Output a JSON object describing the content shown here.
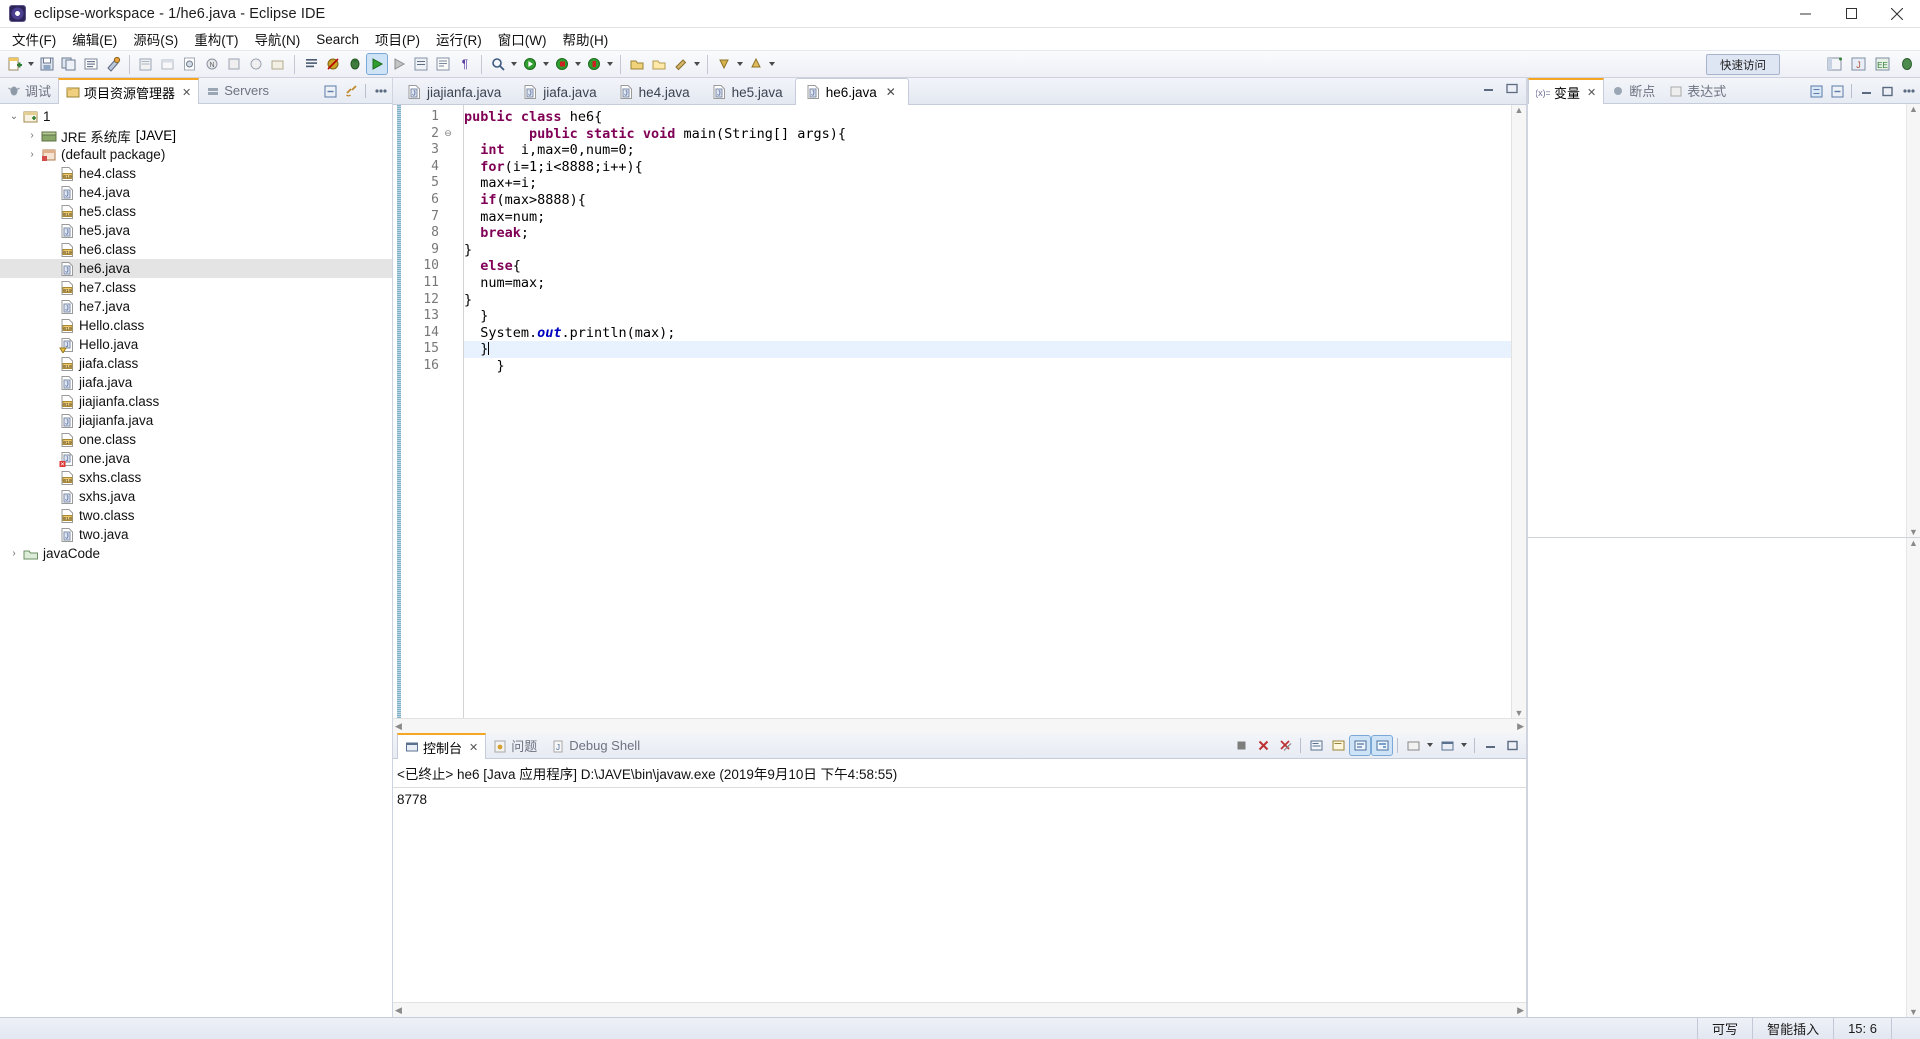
{
  "window": {
    "title": "eclipse-workspace - 1/he6.java - Eclipse IDE",
    "app_icon": "eclipse-icon",
    "minimize": "minimize-icon",
    "maximize": "maximize-icon",
    "close": "close-icon"
  },
  "menubar": {
    "items": [
      {
        "label": "文件(F)",
        "name": "menu-file"
      },
      {
        "label": "编辑(E)",
        "name": "menu-edit"
      },
      {
        "label": "源码(S)",
        "name": "menu-source"
      },
      {
        "label": "重构(T)",
        "name": "menu-refactor"
      },
      {
        "label": "导航(N)",
        "name": "menu-navigate"
      },
      {
        "label": "Search",
        "name": "menu-search"
      },
      {
        "label": "项目(P)",
        "name": "menu-project"
      },
      {
        "label": "运行(R)",
        "name": "menu-run"
      },
      {
        "label": "窗口(W)",
        "name": "menu-window"
      },
      {
        "label": "帮助(H)",
        "name": "menu-help"
      }
    ]
  },
  "toolbar": {
    "quick_access": "快速访问",
    "icons": [
      "new-wizard-icon",
      "save-icon",
      "save-all-icon",
      "print-icon",
      "build-icon",
      "new-java-project-icon",
      "new-package-icon",
      "new-class-icon",
      "new-interface-icon",
      "new-enum-icon",
      "new-annotation-icon",
      "new-source-folder-icon",
      "open-type-icon",
      "search-icon",
      "debug-icon",
      "run-icon",
      "run-external-icon",
      "coverage-icon",
      "java-browsing-icon",
      "open-task-icon",
      "pilcrow-icon",
      "skip-breakpoints-icon",
      "next-annotation-icon",
      "previous-annotation-icon",
      "last-edit-location-icon",
      "back-icon",
      "forward-icon",
      "pin-editor-icon"
    ]
  },
  "left_panel": {
    "tabs": [
      {
        "label": "调试",
        "icon": "debug-icon",
        "active": false,
        "closeable": false
      },
      {
        "label": "项目资源管理器",
        "icon": "package-explorer-icon",
        "active": true,
        "closeable": true
      },
      {
        "label": "Servers",
        "icon": "servers-icon",
        "active": false,
        "closeable": false
      }
    ],
    "view_tools": [
      "collapse-all-icon",
      "link-with-editor-icon",
      "view-menu-icon"
    ],
    "tree": [
      {
        "label": "1",
        "suffix": "",
        "icon": "java-project-icon",
        "indent": 0,
        "twisty": "open",
        "selected": false
      },
      {
        "label": "JRE 系统库",
        "suffix": "[JAVE]",
        "icon": "jre-library-icon",
        "indent": 1,
        "twisty": "closed",
        "selected": false
      },
      {
        "label": "(default package)",
        "suffix": "",
        "icon": "package-icon",
        "indent": 1,
        "twisty": "closed",
        "selected": false
      },
      {
        "label": "he4.class",
        "suffix": "",
        "icon": "class-file-icon",
        "indent": 2,
        "twisty": "none",
        "selected": false
      },
      {
        "label": "he4.java",
        "suffix": "",
        "icon": "java-file-icon",
        "indent": 2,
        "twisty": "none",
        "selected": false
      },
      {
        "label": "he5.class",
        "suffix": "",
        "icon": "class-file-icon",
        "indent": 2,
        "twisty": "none",
        "selected": false
      },
      {
        "label": "he5.java",
        "suffix": "",
        "icon": "java-file-icon",
        "indent": 2,
        "twisty": "none",
        "selected": false
      },
      {
        "label": "he6.class",
        "suffix": "",
        "icon": "class-file-icon",
        "indent": 2,
        "twisty": "none",
        "selected": false
      },
      {
        "label": "he6.java",
        "suffix": "",
        "icon": "java-file-icon",
        "indent": 2,
        "twisty": "none",
        "selected": true
      },
      {
        "label": "he7.class",
        "suffix": "",
        "icon": "class-file-icon",
        "indent": 2,
        "twisty": "none",
        "selected": false
      },
      {
        "label": "he7.java",
        "suffix": "",
        "icon": "java-file-icon",
        "indent": 2,
        "twisty": "none",
        "selected": false
      },
      {
        "label": "Hello.class",
        "suffix": "",
        "icon": "class-file-icon",
        "indent": 2,
        "twisty": "none",
        "selected": false
      },
      {
        "label": "Hello.java",
        "suffix": "",
        "icon": "java-file-warning-icon",
        "indent": 2,
        "twisty": "none",
        "selected": false
      },
      {
        "label": "jiafa.class",
        "suffix": "",
        "icon": "class-file-icon",
        "indent": 2,
        "twisty": "none",
        "selected": false
      },
      {
        "label": "jiafa.java",
        "suffix": "",
        "icon": "java-file-icon",
        "indent": 2,
        "twisty": "none",
        "selected": false
      },
      {
        "label": "jiajianfa.class",
        "suffix": "",
        "icon": "class-file-icon",
        "indent": 2,
        "twisty": "none",
        "selected": false
      },
      {
        "label": "jiajianfa.java",
        "suffix": "",
        "icon": "java-file-icon",
        "indent": 2,
        "twisty": "none",
        "selected": false
      },
      {
        "label": "one.class",
        "suffix": "",
        "icon": "class-file-icon",
        "indent": 2,
        "twisty": "none",
        "selected": false
      },
      {
        "label": "one.java",
        "suffix": "",
        "icon": "java-file-error-icon",
        "indent": 2,
        "twisty": "none",
        "selected": false
      },
      {
        "label": "sxhs.class",
        "suffix": "",
        "icon": "class-file-icon",
        "indent": 2,
        "twisty": "none",
        "selected": false
      },
      {
        "label": "sxhs.java",
        "suffix": "",
        "icon": "java-file-icon",
        "indent": 2,
        "twisty": "none",
        "selected": false
      },
      {
        "label": "two.class",
        "suffix": "",
        "icon": "class-file-icon",
        "indent": 2,
        "twisty": "none",
        "selected": false
      },
      {
        "label": "two.java",
        "suffix": "",
        "icon": "java-file-icon",
        "indent": 2,
        "twisty": "none",
        "selected": false
      },
      {
        "label": "javaCode",
        "suffix": "",
        "icon": "closed-project-icon",
        "indent": 0,
        "twisty": "closed",
        "selected": false
      }
    ]
  },
  "editor": {
    "tabs": [
      {
        "label": "jiajianfa.java",
        "icon": "java-file-icon",
        "active": false,
        "closeable": false
      },
      {
        "label": "jiafa.java",
        "icon": "java-file-icon",
        "active": false,
        "closeable": false
      },
      {
        "label": "he4.java",
        "icon": "java-file-icon",
        "active": false,
        "closeable": false
      },
      {
        "label": "he5.java",
        "icon": "java-file-icon",
        "active": false,
        "closeable": false
      },
      {
        "label": "he6.java",
        "icon": "java-file-icon",
        "active": true,
        "closeable": true
      }
    ],
    "minimize_icon": "minimize-view-icon",
    "maximize_icon": "maximize-view-icon",
    "line_numbers": [
      1,
      2,
      3,
      4,
      5,
      6,
      7,
      8,
      9,
      10,
      11,
      12,
      13,
      14,
      15,
      16
    ],
    "current_line": 15,
    "fold_marker_line": 2,
    "code": [
      {
        "n": 1,
        "tokens": [
          {
            "t": "public ",
            "c": "k"
          },
          {
            "t": "class ",
            "c": "k"
          },
          {
            "t": "he6{",
            "c": "plain"
          }
        ]
      },
      {
        "n": 2,
        "tokens": [
          {
            "t": "        public ",
            "c": "k"
          },
          {
            "t": "static ",
            "c": "k"
          },
          {
            "t": "void ",
            "c": "k"
          },
          {
            "t": "main(String[] args){",
            "c": "plain"
          }
        ]
      },
      {
        "n": 3,
        "tokens": [
          {
            "t": "  int ",
            "c": "k"
          },
          {
            "t": " i,max=0,num=0;",
            "c": "plain"
          }
        ]
      },
      {
        "n": 4,
        "tokens": [
          {
            "t": "  for",
            "c": "k"
          },
          {
            "t": "(i=1;i<8888;i++){",
            "c": "plain"
          }
        ]
      },
      {
        "n": 5,
        "tokens": [
          {
            "t": "  max+=i;",
            "c": "plain"
          }
        ]
      },
      {
        "n": 6,
        "tokens": [
          {
            "t": "  if",
            "c": "k"
          },
          {
            "t": "(max>8888){",
            "c": "plain"
          }
        ]
      },
      {
        "n": 7,
        "tokens": [
          {
            "t": "  max=num;",
            "c": "plain"
          }
        ]
      },
      {
        "n": 8,
        "tokens": [
          {
            "t": "  break",
            "c": "k"
          },
          {
            "t": ";",
            "c": "plain"
          }
        ]
      },
      {
        "n": 9,
        "tokens": [
          {
            "t": "}",
            "c": "plain"
          }
        ]
      },
      {
        "n": 10,
        "tokens": [
          {
            "t": "  else",
            "c": "k"
          },
          {
            "t": "{",
            "c": "plain"
          }
        ]
      },
      {
        "n": 11,
        "tokens": [
          {
            "t": "  num=max;",
            "c": "plain"
          }
        ]
      },
      {
        "n": 12,
        "tokens": [
          {
            "t": "}",
            "c": "plain"
          }
        ]
      },
      {
        "n": 13,
        "tokens": [
          {
            "t": "  }",
            "c": "plain"
          }
        ]
      },
      {
        "n": 14,
        "tokens": [
          {
            "t": "  System.",
            "c": "plain"
          },
          {
            "t": "out",
            "c": "fieldi"
          },
          {
            "t": ".println(max);",
            "c": "plain"
          }
        ]
      },
      {
        "n": 15,
        "tokens": [
          {
            "t": "  }",
            "c": "plain"
          }
        ]
      },
      {
        "n": 16,
        "tokens": [
          {
            "t": "    }",
            "c": "plain"
          }
        ]
      }
    ]
  },
  "right_panel": {
    "tabs": [
      {
        "label": "变量",
        "icon": "variables-icon",
        "active": true,
        "closeable": true
      },
      {
        "label": "断点",
        "icon": "breakpoints-icon",
        "active": false,
        "closeable": false
      },
      {
        "label": "表达式",
        "icon": "expressions-icon",
        "active": false,
        "closeable": false
      }
    ],
    "tools": [
      "collapse-all-icon",
      "show-logical-structure-icon",
      "minimize-view-icon",
      "maximize-view-icon",
      "view-menu-icon"
    ]
  },
  "console": {
    "tabs": [
      {
        "label": "控制台",
        "icon": "console-icon",
        "active": true,
        "closeable": true
      },
      {
        "label": "问题",
        "icon": "problems-icon",
        "active": false,
        "closeable": false
      },
      {
        "label": "Debug Shell",
        "icon": "debug-shell-icon",
        "active": false,
        "closeable": false
      }
    ],
    "tools": [
      "terminate-icon",
      "remove-launch-icon",
      "remove-all-terminated-icon",
      "show-console-when-output-icon",
      "pin-console-icon",
      "display-selected-console-icon",
      "open-console-icon",
      "scroll-lock-icon",
      "word-wrap-icon",
      "clear-console-icon",
      "minimize-view-icon",
      "maximize-view-icon"
    ],
    "launch_line": "<已终止> he6 [Java 应用程序] D:\\JAVE\\bin\\javaw.exe  (2019年9月10日 下午4:58:55)",
    "output": "8778"
  },
  "statusbar": {
    "writable": "可写",
    "insert_mode": "智能插入",
    "cursor_position": "15: 6"
  },
  "colors": {
    "accent_orange": "#f5a623",
    "keyword_purple": "#7f0055",
    "field_blue": "#0000c0",
    "selection_blue": "#e8f2fe",
    "chrome_blue": "#e3e8f1"
  }
}
